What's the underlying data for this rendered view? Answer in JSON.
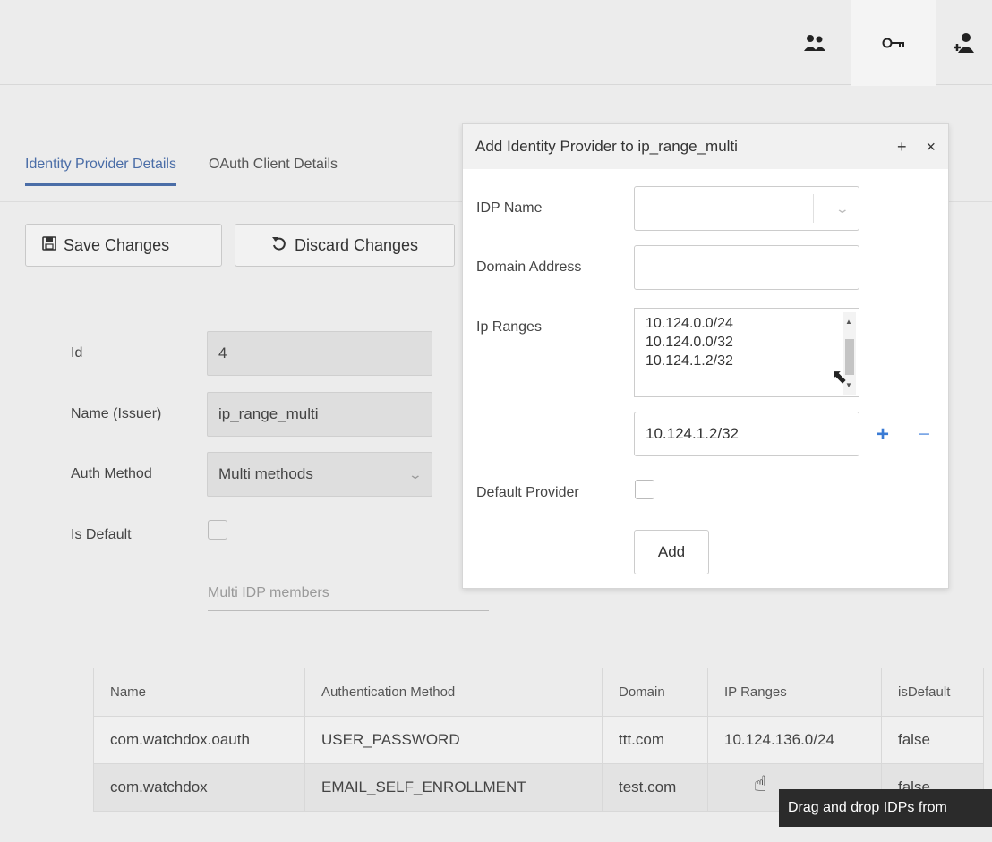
{
  "topbar": {
    "icons": [
      "users-icon",
      "key-icon",
      "add-user-icon"
    ]
  },
  "tabs": [
    {
      "label": "Identity Provider Details",
      "active": true
    },
    {
      "label": "OAuth Client Details",
      "active": false
    }
  ],
  "toolbar": {
    "save_label": "Save Changes",
    "discard_label": "Discard Changes"
  },
  "form": {
    "id_label": "Id",
    "id_value": "4",
    "name_label": "Name (Issuer)",
    "name_value": "ip_range_multi",
    "auth_label": "Auth Method",
    "auth_value": "Multi methods",
    "default_label": "Is Default",
    "multi_members_label": "Multi IDP members"
  },
  "table": {
    "headers": [
      "Name",
      "Authentication Method",
      "Domain",
      "IP Ranges",
      "isDefault"
    ],
    "rows": [
      [
        "com.watchdox.oauth",
        "USER_PASSWORD",
        "ttt.com",
        "10.124.136.0/24",
        "false"
      ],
      [
        "com.watchdox",
        "EMAIL_SELF_ENROLLMENT",
        "test.com",
        "",
        "false"
      ]
    ]
  },
  "modal": {
    "title": "Add Identity Provider to ip_range_multi",
    "plus": "+",
    "close": "×",
    "idp_name_label": "IDP Name",
    "domain_label": "Domain Address",
    "ip_ranges_label": "Ip Ranges",
    "ip_ranges": [
      "10.124.0.0/24",
      "10.124.0.0/32",
      "10.124.1.2/32"
    ],
    "ip_input_value": "10.124.1.2/32",
    "add_range": "+",
    "remove_range": "−",
    "default_label": "Default Provider",
    "add_label": "Add"
  },
  "tooltip": "Drag and drop IDPs from",
  "colors": {
    "accent": "#4a6da7",
    "plus": "#3a7bd5"
  }
}
